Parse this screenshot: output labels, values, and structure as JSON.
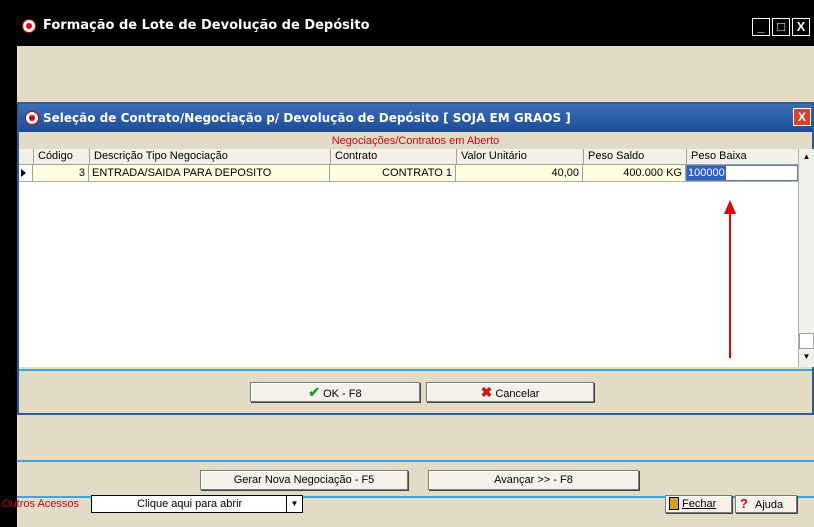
{
  "outer_window": {
    "title": "Formação de Lote de Devolução de Depósito",
    "minimize": "_",
    "maximize": "□",
    "close": "X"
  },
  "dialog": {
    "title": "Seleção de Contrato/Negociação p/ Devolução de Depósito [ SOJA EM GRAOS ]",
    "close": "X",
    "grid_caption": "Negociações/Contratos em Aberto",
    "columns": [
      "Código",
      "Descrição Tipo Negociação",
      "Contrato",
      "Valor Unitário",
      "Peso Saldo",
      "Peso Baixa"
    ],
    "rows": [
      {
        "codigo": "3",
        "descricao": "ENTRADA/SAIDA PARA DEPOSITO",
        "contrato": "CONTRATO 1",
        "valor_unitario": "40,00",
        "peso_saldo": "400.000 KG",
        "peso_baixa": "100000"
      }
    ],
    "ok_label": "OK - F8",
    "cancel_label": "Cancelar"
  },
  "bottom": {
    "gerar_label": "Gerar Nova Negociação - F5",
    "avancar_label": "Avançar >> - F8",
    "outros_label": "Outros Acessos",
    "combo_value": "Clique aqui para abrir",
    "fechar_label": "Fechar",
    "ajuda_label": "Ajuda"
  },
  "colors": {
    "panel_bg": "#e2dcc6",
    "separator": "#3aa7d8",
    "caption_red": "#d0021b",
    "arrow_red": "#e00000"
  }
}
